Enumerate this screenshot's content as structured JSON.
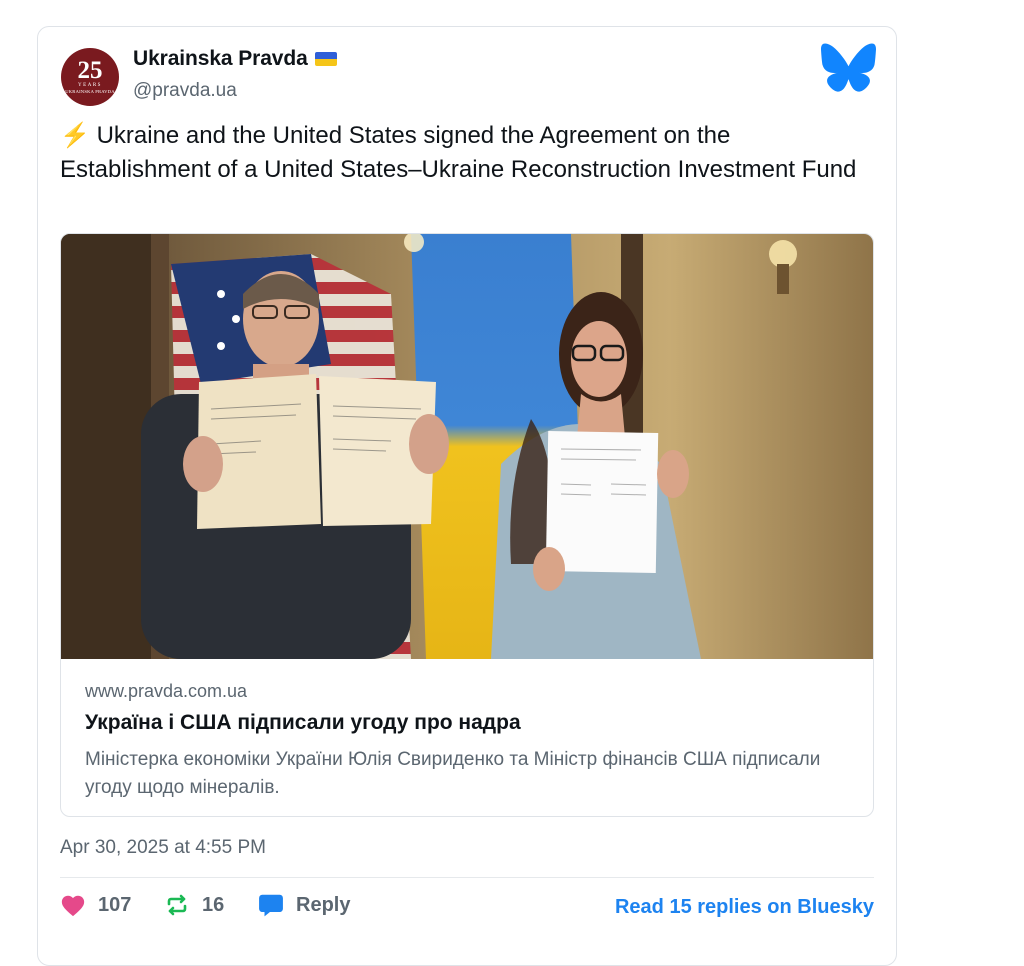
{
  "post": {
    "author": {
      "display_name": "Ukrainska Pravda",
      "handle": "@pravda.ua",
      "avatar": {
        "number": "25",
        "years_label": "YEARS",
        "brand": "UKRAINSKA PRAVDA"
      },
      "flag_icon": "ukraine-flag"
    },
    "platform_icon": "bluesky-butterfly",
    "text_icon": "lightning",
    "text": "Ukraine and the United States signed the Agreement on the Establishment of a United States–Ukraine Reconstruction Investment Fund",
    "embed": {
      "image_description": "photo",
      "domain": "www.pravda.com.ua",
      "title": "Україна і США підписали угоду про надра",
      "description": "Міністерка економіки України Юлія Свириденко та Міністр фінансів США підписали угоду щодо мінералів."
    },
    "timestamp": "Apr 30, 2025 at 4:55 PM",
    "actions": {
      "likes": "107",
      "reposts": "16",
      "reply_label": "Reply",
      "read_replies_label": "Read 15 replies on Bluesky"
    }
  },
  "colors": {
    "accent": "#1d83f0",
    "like": "#e5498a",
    "repost": "#1bb954",
    "reply": "#1d83f0",
    "muted": "#5b6670"
  }
}
